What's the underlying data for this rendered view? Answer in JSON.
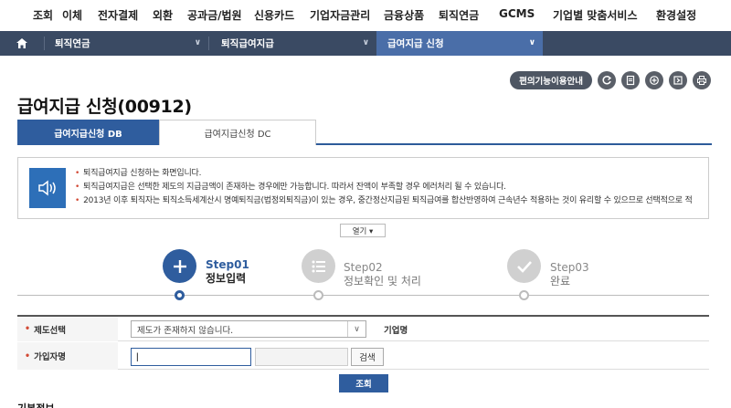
{
  "top_nav": [
    "조회",
    "이체",
    "전자결제",
    "외환",
    "공과금/법원",
    "신용카드",
    "기업자금관리",
    "금융상품",
    "퇴직연금",
    "GCMS",
    "기업별 맞춤서비스",
    "환경설정"
  ],
  "breadcrumb": {
    "home_icon": "home-icon",
    "items": [
      "퇴직연금",
      "퇴직급여지급",
      "급여지급 신청"
    ]
  },
  "toolbar": {
    "guide_label": "편의기능이용안내",
    "icons": [
      "refresh-icon",
      "memo-icon",
      "zoom-in-icon",
      "export-icon",
      "print-icon"
    ]
  },
  "page": {
    "title": "급여지급 신청(00912)"
  },
  "tabs": [
    {
      "label": "급여지급신청 DB",
      "active": true
    },
    {
      "label": "급여지급신청 DC",
      "active": false
    }
  ],
  "notice": {
    "icon": "speaker-icon",
    "items": [
      "퇴직급여지급 신청하는 화면입니다.",
      "퇴직급여지급은 선택한 제도의 지급금액이 존재하는 경우에만 가능합니다.  따라서 잔액이 부족할 경우 에러처리 될 수 있습니다.",
      "2013년 이후 퇴직자는 퇴직소득세계산시 명예퇴직금(법정외퇴직금)이 있는 경우, 중간정산지급된 퇴직급여를 합산반영하여 근속년수 적용하는 것이 유리할 수 있으므로 선택적으로 적"
    ],
    "open_label": "열기 ▾"
  },
  "steps": [
    {
      "num": "Step01",
      "label": "정보입력",
      "active": true,
      "icon": "plus-icon"
    },
    {
      "num": "Step02",
      "label": "정보확인 및 처리",
      "active": false,
      "icon": "list-icon"
    },
    {
      "num": "Step03",
      "label": "완료",
      "active": false,
      "icon": "check-icon"
    }
  ],
  "form": {
    "scheme_label": "제도선택",
    "scheme_value": "제도가 존재하지 않습니다.",
    "company_label": "기업명",
    "company_value": "",
    "member_label": "가입자명",
    "member_value": "|",
    "member_value2": "",
    "search_label": "검색",
    "query_label": "조회"
  },
  "bottom_text": "기본정보"
}
